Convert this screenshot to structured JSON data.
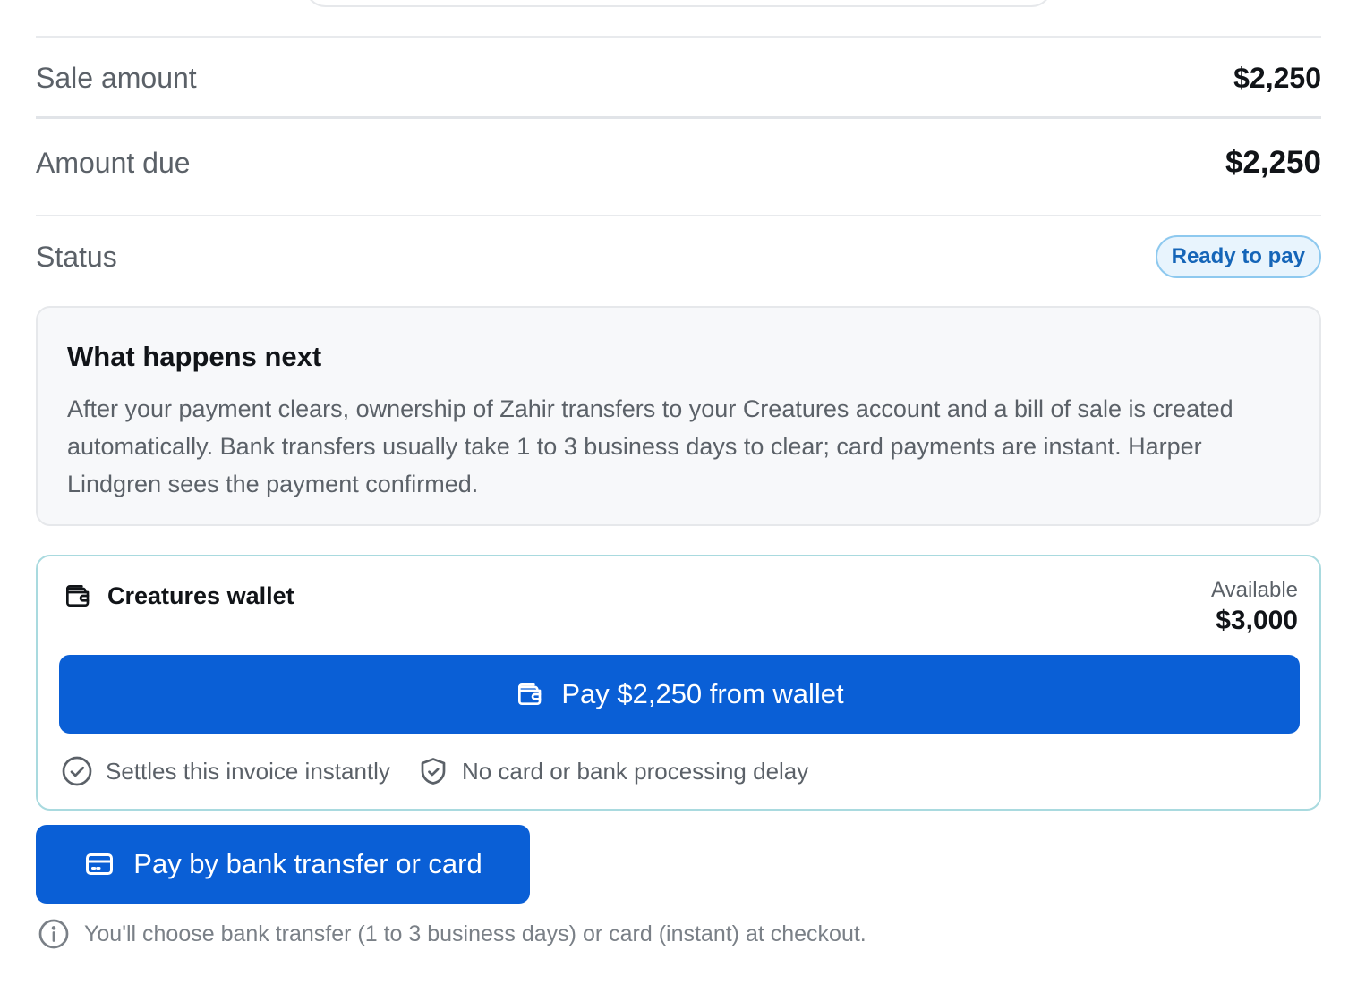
{
  "summary": {
    "sale_amount_label": "Sale amount",
    "sale_amount_value": "$2,250",
    "amount_due_label": "Amount due",
    "amount_due_value": "$2,250",
    "status_label": "Status",
    "status_value": "Ready to pay"
  },
  "next_steps": {
    "title": "What happens next",
    "body": "After your payment clears, ownership of Zahir transfers to your Creatures account and a bill of sale is created automatically. Bank transfers usually take 1 to 3 business days to clear; card payments are instant. Harper Lindgren sees the payment confirmed."
  },
  "wallet": {
    "title": "Creatures wallet",
    "icon": "wallet-icon",
    "available_label": "Available",
    "available_value": "$3,000",
    "pay_button_label": "Pay $2,250 from wallet",
    "features": [
      {
        "icon": "check-circle-icon",
        "label": "Settles this invoice instantly"
      },
      {
        "icon": "shield-check-icon",
        "label": "No card or bank processing delay"
      }
    ]
  },
  "bank_card": {
    "icon": "credit-card-icon",
    "button_label": "Pay by bank transfer or card",
    "note_icon": "info-icon",
    "note": "You'll choose bank transfer (1 to 3 business days) or card (instant) at checkout."
  },
  "colors": {
    "primary": "#0a5fd6",
    "badge_text": "#1565b8",
    "badge_bg": "#e8f4fd",
    "badge_border": "#8ec9ef",
    "wallet_border": "#a9dadf"
  }
}
